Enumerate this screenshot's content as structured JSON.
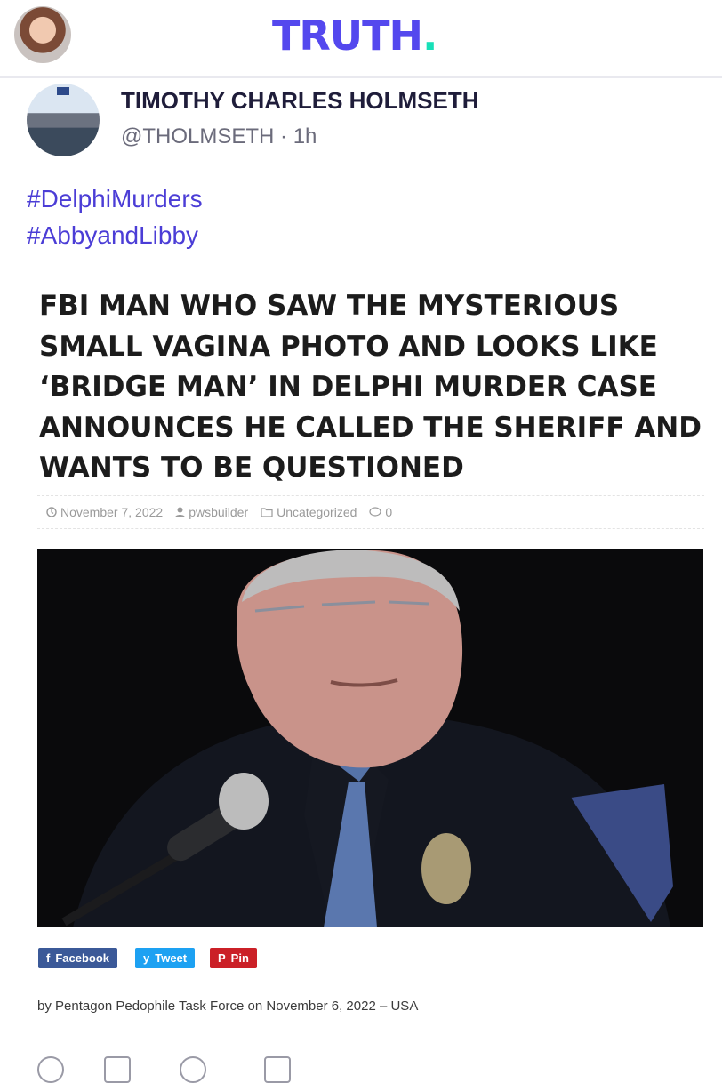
{
  "app": {
    "logo_text": "TRUTH",
    "logo_dot": ".",
    "brand_color": "#5448ee",
    "accent_color": "#17e0b8"
  },
  "post": {
    "author": "TIMOTHY CHARLES HOLMSETH",
    "handle_time": "@THOLMSETH · 1h",
    "hashtags": [
      "#DelphiMurders",
      "#AbbyandLibby"
    ]
  },
  "article": {
    "title_lines": [
      "FBI MAN WHO SAW THE MYSTERIOUS",
      "SMALL VAGINA PHOTO AND LOOKS LIKE",
      "‘BRIDGE MAN’ IN DELPHI MURDER CASE",
      "ANNOUNCES HE CALLED THE SHERIFF AND",
      "WANTS TO BE QUESTIONED"
    ],
    "meta": {
      "date": "November 7, 2022",
      "author": "pwsbuilder",
      "category": "Uncategorized",
      "comments": "0"
    },
    "share": {
      "facebook": "Facebook",
      "tweet": "Tweet",
      "pin": "Pin"
    },
    "byline": "by Pentagon Pedophile Task Force on November 6, 2022 – USA"
  },
  "icons": [
    "clock-icon",
    "user-icon",
    "folder-icon",
    "comment-icon",
    "facebook-icon",
    "twitter-icon",
    "pinterest-icon"
  ]
}
